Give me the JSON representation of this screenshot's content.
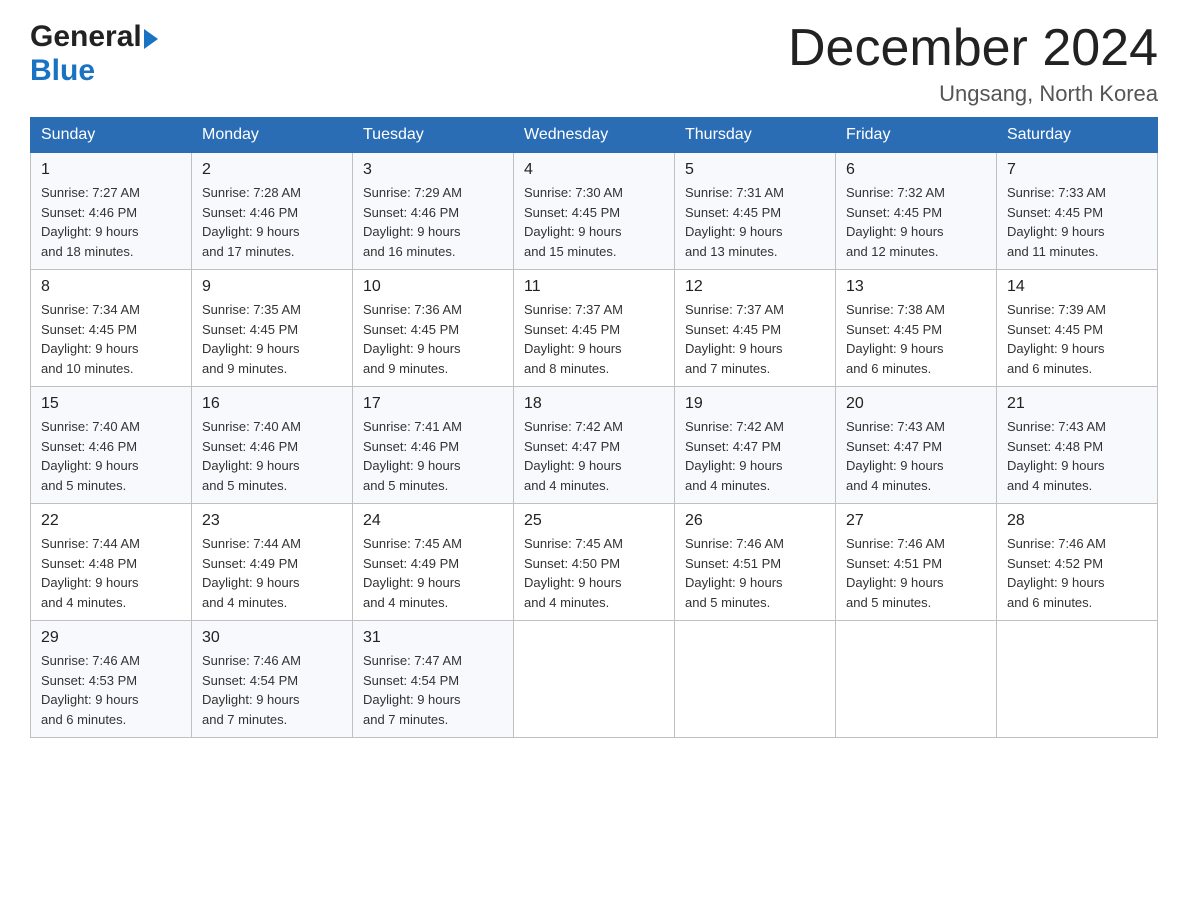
{
  "logo": {
    "general": "General",
    "blue": "Blue"
  },
  "title": "December 2024",
  "location": "Ungsang, North Korea",
  "days_of_week": [
    "Sunday",
    "Monday",
    "Tuesday",
    "Wednesday",
    "Thursday",
    "Friday",
    "Saturday"
  ],
  "weeks": [
    [
      {
        "day": "1",
        "sunrise": "7:27 AM",
        "sunset": "4:46 PM",
        "daylight": "9 hours and 18 minutes."
      },
      {
        "day": "2",
        "sunrise": "7:28 AM",
        "sunset": "4:46 PM",
        "daylight": "9 hours and 17 minutes."
      },
      {
        "day": "3",
        "sunrise": "7:29 AM",
        "sunset": "4:46 PM",
        "daylight": "9 hours and 16 minutes."
      },
      {
        "day": "4",
        "sunrise": "7:30 AM",
        "sunset": "4:45 PM",
        "daylight": "9 hours and 15 minutes."
      },
      {
        "day": "5",
        "sunrise": "7:31 AM",
        "sunset": "4:45 PM",
        "daylight": "9 hours and 13 minutes."
      },
      {
        "day": "6",
        "sunrise": "7:32 AM",
        "sunset": "4:45 PM",
        "daylight": "9 hours and 12 minutes."
      },
      {
        "day": "7",
        "sunrise": "7:33 AM",
        "sunset": "4:45 PM",
        "daylight": "9 hours and 11 minutes."
      }
    ],
    [
      {
        "day": "8",
        "sunrise": "7:34 AM",
        "sunset": "4:45 PM",
        "daylight": "9 hours and 10 minutes."
      },
      {
        "day": "9",
        "sunrise": "7:35 AM",
        "sunset": "4:45 PM",
        "daylight": "9 hours and 9 minutes."
      },
      {
        "day": "10",
        "sunrise": "7:36 AM",
        "sunset": "4:45 PM",
        "daylight": "9 hours and 9 minutes."
      },
      {
        "day": "11",
        "sunrise": "7:37 AM",
        "sunset": "4:45 PM",
        "daylight": "9 hours and 8 minutes."
      },
      {
        "day": "12",
        "sunrise": "7:37 AM",
        "sunset": "4:45 PM",
        "daylight": "9 hours and 7 minutes."
      },
      {
        "day": "13",
        "sunrise": "7:38 AM",
        "sunset": "4:45 PM",
        "daylight": "9 hours and 6 minutes."
      },
      {
        "day": "14",
        "sunrise": "7:39 AM",
        "sunset": "4:45 PM",
        "daylight": "9 hours and 6 minutes."
      }
    ],
    [
      {
        "day": "15",
        "sunrise": "7:40 AM",
        "sunset": "4:46 PM",
        "daylight": "9 hours and 5 minutes."
      },
      {
        "day": "16",
        "sunrise": "7:40 AM",
        "sunset": "4:46 PM",
        "daylight": "9 hours and 5 minutes."
      },
      {
        "day": "17",
        "sunrise": "7:41 AM",
        "sunset": "4:46 PM",
        "daylight": "9 hours and 5 minutes."
      },
      {
        "day": "18",
        "sunrise": "7:42 AM",
        "sunset": "4:47 PM",
        "daylight": "9 hours and 4 minutes."
      },
      {
        "day": "19",
        "sunrise": "7:42 AM",
        "sunset": "4:47 PM",
        "daylight": "9 hours and 4 minutes."
      },
      {
        "day": "20",
        "sunrise": "7:43 AM",
        "sunset": "4:47 PM",
        "daylight": "9 hours and 4 minutes."
      },
      {
        "day": "21",
        "sunrise": "7:43 AM",
        "sunset": "4:48 PM",
        "daylight": "9 hours and 4 minutes."
      }
    ],
    [
      {
        "day": "22",
        "sunrise": "7:44 AM",
        "sunset": "4:48 PM",
        "daylight": "9 hours and 4 minutes."
      },
      {
        "day": "23",
        "sunrise": "7:44 AM",
        "sunset": "4:49 PM",
        "daylight": "9 hours and 4 minutes."
      },
      {
        "day": "24",
        "sunrise": "7:45 AM",
        "sunset": "4:49 PM",
        "daylight": "9 hours and 4 minutes."
      },
      {
        "day": "25",
        "sunrise": "7:45 AM",
        "sunset": "4:50 PM",
        "daylight": "9 hours and 4 minutes."
      },
      {
        "day": "26",
        "sunrise": "7:46 AM",
        "sunset": "4:51 PM",
        "daylight": "9 hours and 5 minutes."
      },
      {
        "day": "27",
        "sunrise": "7:46 AM",
        "sunset": "4:51 PM",
        "daylight": "9 hours and 5 minutes."
      },
      {
        "day": "28",
        "sunrise": "7:46 AM",
        "sunset": "4:52 PM",
        "daylight": "9 hours and 6 minutes."
      }
    ],
    [
      {
        "day": "29",
        "sunrise": "7:46 AM",
        "sunset": "4:53 PM",
        "daylight": "9 hours and 6 minutes."
      },
      {
        "day": "30",
        "sunrise": "7:46 AM",
        "sunset": "4:54 PM",
        "daylight": "9 hours and 7 minutes."
      },
      {
        "day": "31",
        "sunrise": "7:47 AM",
        "sunset": "4:54 PM",
        "daylight": "9 hours and 7 minutes."
      },
      null,
      null,
      null,
      null
    ]
  ],
  "labels": {
    "sunrise": "Sunrise:",
    "sunset": "Sunset:",
    "daylight": "Daylight:"
  }
}
